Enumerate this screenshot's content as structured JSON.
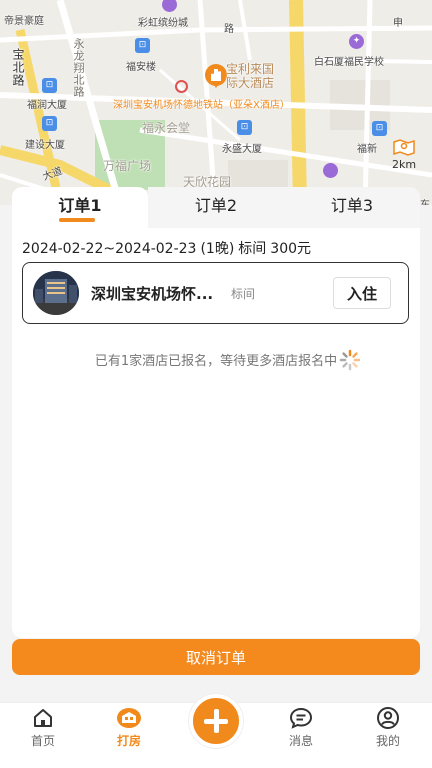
{
  "map": {
    "labels": {
      "dijinghaoting": "帝景豪庭",
      "caihongbinfencheng": "彩虹缤纷城",
      "fuanlou": "福安楼",
      "runingdasha": "福润大厦",
      "jianshedasha": "建设大厦",
      "baoliguoji": "宝利来国\n际大酒店",
      "fuyonghuitang": "福永会堂",
      "wanfuguangchang": "万福广场",
      "yongshengdasha": "永盛大厦",
      "tianxinhuayuan": "天欣花园",
      "baishixiafumin": "白石厦福民学校",
      "fuxin": "福新",
      "dong": "东",
      "target_hotel": "深圳宝安机场怀德地铁站（亚朵X酒店）",
      "road_north": "宝北路",
      "road_yonglong": "永龙翔北路",
      "road_avenue": "大道",
      "road_zhong": "申",
      "road_lu": "路"
    },
    "scale_label": "2km"
  },
  "tabs": [
    {
      "label": "订单1",
      "active": true
    },
    {
      "label": "订单2",
      "active": false
    },
    {
      "label": "订单3",
      "active": false
    }
  ],
  "order": {
    "dates": "2024-02-22~2024-02-23",
    "nights": "(1晚)",
    "room": "标间",
    "price": "300元",
    "hotel_name": "深圳宝安机场怀...",
    "room_type": "标间",
    "checkin_label": "入住",
    "status_text": "已有1家酒店已报名，等待更多酒店报名中"
  },
  "cancel_label": "取消订单",
  "nav": [
    {
      "label": "首页",
      "icon": "home-icon"
    },
    {
      "label": "打房",
      "icon": "hotel-icon",
      "active": true
    },
    {
      "label": "",
      "icon": "plus-icon"
    },
    {
      "label": "消息",
      "icon": "message-icon"
    },
    {
      "label": "我的",
      "icon": "profile-icon"
    }
  ],
  "colors": {
    "accent": "#f08a1c",
    "map_bg": "#efede8"
  }
}
